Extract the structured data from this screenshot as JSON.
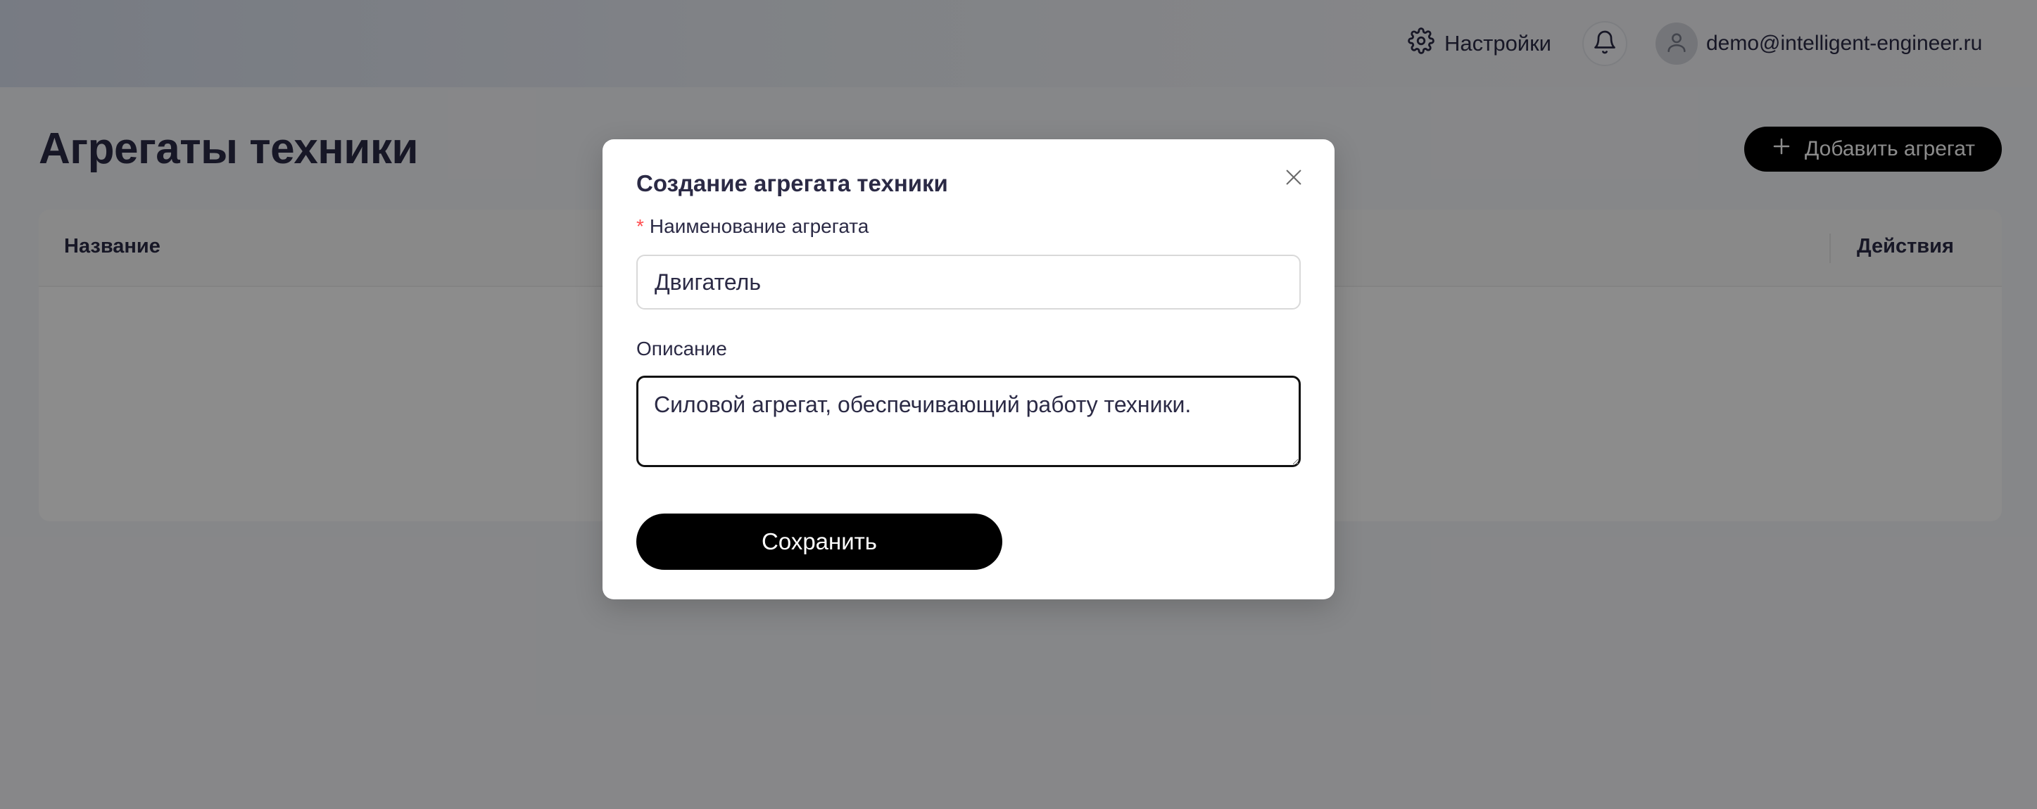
{
  "header": {
    "settings_label": "Настройки",
    "settings_icon": "gear-icon",
    "notifications_icon": "bell-icon",
    "user_email": "demo@intelligent-engineer.ru",
    "avatar_icon": "user-icon"
  },
  "main": {
    "title": "Агрегаты техники",
    "add_button_label": "Добавить агрегат",
    "table": {
      "columns": [
        "Название",
        "Действия"
      ],
      "rows": []
    }
  },
  "modal": {
    "title": "Создание агрегата техники",
    "name_label": "Наименование агрегата",
    "required_mark": "*",
    "name_value": "Двигатель",
    "description_label": "Описание",
    "description_value": "Силовой агрегат, обеспечивающий работу техники.",
    "save_label": "Сохранить"
  },
  "colors": {
    "primary_button": "#000000",
    "text": "#2b2a45",
    "required": "#ff4d4f"
  }
}
